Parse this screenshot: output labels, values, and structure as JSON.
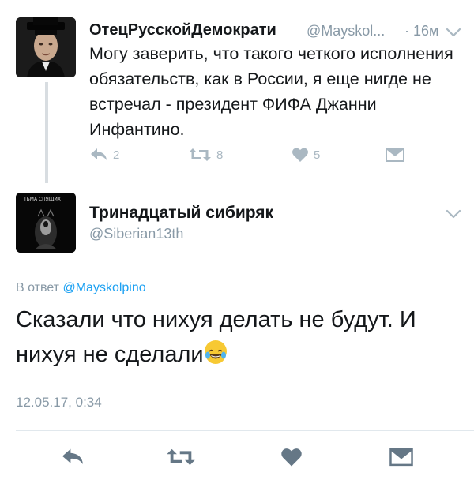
{
  "parent_tweet": {
    "display_name": "ОтецРусскойДемократи",
    "handle": "@Mayskol...",
    "time": "· 16м",
    "text": "Могу заверить, что такого четкого исполнения обязательств, как в России, я еще нигде не встречал - президент ФИФА Джанни Инфантино.",
    "replies": "2",
    "retweets": "8",
    "likes": "5"
  },
  "main_tweet": {
    "avatar_text": "ТЬМА СПЯЩИХ",
    "display_name": "Тринадцатый сибиряк",
    "handle": "@Siberian13th",
    "reply_prefix": "В ответ",
    "reply_handle": "@Mayskolpino",
    "text": "Сказали что нихуя делать не будут. И нихуя не сделали",
    "emoji": "face-with-tears-of-joy",
    "timestamp": "12.05.17, 0:34"
  },
  "colors": {
    "text": "#14171a",
    "muted": "#8899a6",
    "icon": "#aab8c2",
    "link": "#1da1f2",
    "main_action_icon": "#657786"
  }
}
